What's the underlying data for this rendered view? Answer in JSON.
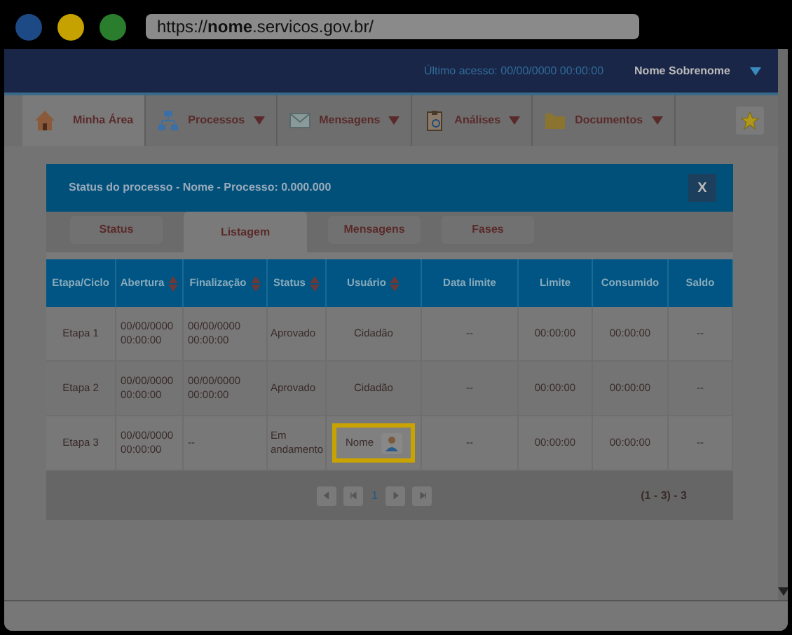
{
  "browser": {
    "url": "https://**nome**.servicos.gov.br/"
  },
  "header": {
    "last_access": "Último acesso: 00/00/0000 00:00:00",
    "user_name": "Nome Sobrenome"
  },
  "nav": [
    {
      "label": "Minha Área",
      "kind": "house",
      "dropdown": false,
      "selected": true
    },
    {
      "label": "Processos",
      "kind": "network",
      "dropdown": true,
      "selected": false
    },
    {
      "label": "Mensagens",
      "kind": "envelope",
      "dropdown": true,
      "selected": false
    },
    {
      "label": "Análises",
      "kind": "clipboard",
      "dropdown": true,
      "selected": false
    },
    {
      "label": "Documentos",
      "kind": "folder",
      "dropdown": true,
      "selected": false
    }
  ],
  "modal": {
    "title": "Status do processo - Nome - Processo: 0.000.000",
    "close": "X",
    "tabs": [
      {
        "label": "Status",
        "selected": false
      },
      {
        "label": "Listagem",
        "selected": true
      },
      {
        "label": "Mensagens",
        "selected": false
      },
      {
        "label": "Fases",
        "selected": false
      }
    ],
    "table": {
      "columns": [
        {
          "label": "Etapa/Ciclo",
          "sortable": false
        },
        {
          "label": "Abertura",
          "sortable": true
        },
        {
          "label": "Finalização",
          "sortable": true
        },
        {
          "label": "Status",
          "sortable": true
        },
        {
          "label": "Usuário",
          "sortable": true
        },
        {
          "label": "Data limite",
          "sortable": false
        },
        {
          "label": "Limite",
          "sortable": false
        },
        {
          "label": "Consumido",
          "sortable": false
        },
        {
          "label": "Saldo",
          "sortable": false
        }
      ],
      "rows": [
        {
          "highlighted": false,
          "cells": [
            "Etapa 1",
            "00/00/0000 00:00:00",
            "00/00/0000 00:00:00",
            "Aprovado",
            "Cidadão",
            "--",
            "00:00:00",
            "00:00:00",
            "--"
          ]
        },
        {
          "highlighted": false,
          "cells": [
            "Etapa 2",
            "00/00/0000 00:00:00",
            "00/00/0000 00:00:00",
            "Aprovado",
            "Cidadão",
            "--",
            "00:00:00",
            "00:00:00",
            "--"
          ]
        },
        {
          "highlighted": true,
          "cells": [
            "Etapa 3",
            "00/00/0000 00:00:00",
            "--",
            "Em andamento",
            "Nome",
            "--",
            "00:00:00",
            "00:00:00",
            "--"
          ]
        }
      ]
    },
    "pagination": {
      "page": "1",
      "range": "(1 - 3) - 3"
    }
  }
}
